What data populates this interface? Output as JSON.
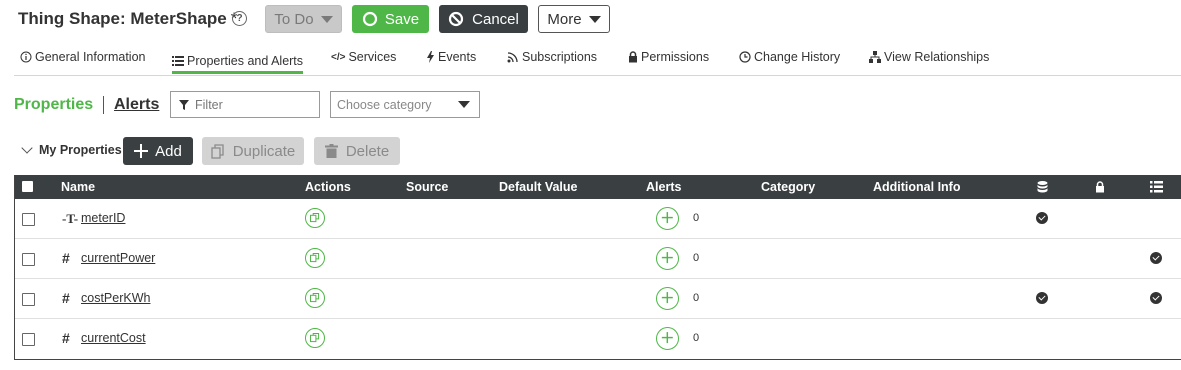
{
  "header": {
    "title": "Thing Shape: MeterShape",
    "unsaved_marker": "*",
    "help_glyph": "?",
    "todo_label": "To Do",
    "save_label": "Save",
    "cancel_label": "Cancel",
    "more_label": "More"
  },
  "tabs": [
    {
      "label": "General Information",
      "icon": "info-icon"
    },
    {
      "label": "Properties and Alerts",
      "icon": "list-icon",
      "active": true
    },
    {
      "label": "Services",
      "icon": "code-icon"
    },
    {
      "label": "Events",
      "icon": "bolt-icon"
    },
    {
      "label": "Subscriptions",
      "icon": "rss-icon"
    },
    {
      "label": "Permissions",
      "icon": "lock-icon"
    },
    {
      "label": "Change History",
      "icon": "clock-icon"
    },
    {
      "label": "View Relationships",
      "icon": "sitemap-icon"
    }
  ],
  "subnav": {
    "properties_label": "Properties",
    "alerts_label": "Alerts",
    "filter_placeholder": "Filter",
    "category_placeholder": "Choose category"
  },
  "toolbar": {
    "section_label": "My Properties",
    "add_label": "Add",
    "duplicate_label": "Duplicate",
    "delete_label": "Delete"
  },
  "table": {
    "columns": [
      "Name",
      "Actions",
      "Source",
      "Default Value",
      "Alerts",
      "Category",
      "Additional Info"
    ],
    "icon_columns": [
      "database-icon",
      "lock-icon",
      "list-icon"
    ],
    "rows": [
      {
        "name": "meterID",
        "type_icon": "text-type-icon",
        "type_glyph": "-T-",
        "alerts": "0",
        "persistent": true,
        "read_only": false,
        "logged": false
      },
      {
        "name": "currentPower",
        "type_icon": "number-type-icon",
        "type_glyph": "#",
        "alerts": "0",
        "persistent": false,
        "read_only": false,
        "logged": true
      },
      {
        "name": "costPerKWh",
        "type_icon": "number-type-icon",
        "type_glyph": "#",
        "alerts": "0",
        "persistent": true,
        "read_only": false,
        "logged": true
      },
      {
        "name": "currentCost",
        "type_icon": "number-type-icon",
        "type_glyph": "#",
        "alerts": "0",
        "persistent": false,
        "read_only": false,
        "logged": false
      }
    ]
  },
  "colors": {
    "accent": "#4fb748",
    "dark": "#3a3f42",
    "disabled": "#d3d3d3"
  }
}
